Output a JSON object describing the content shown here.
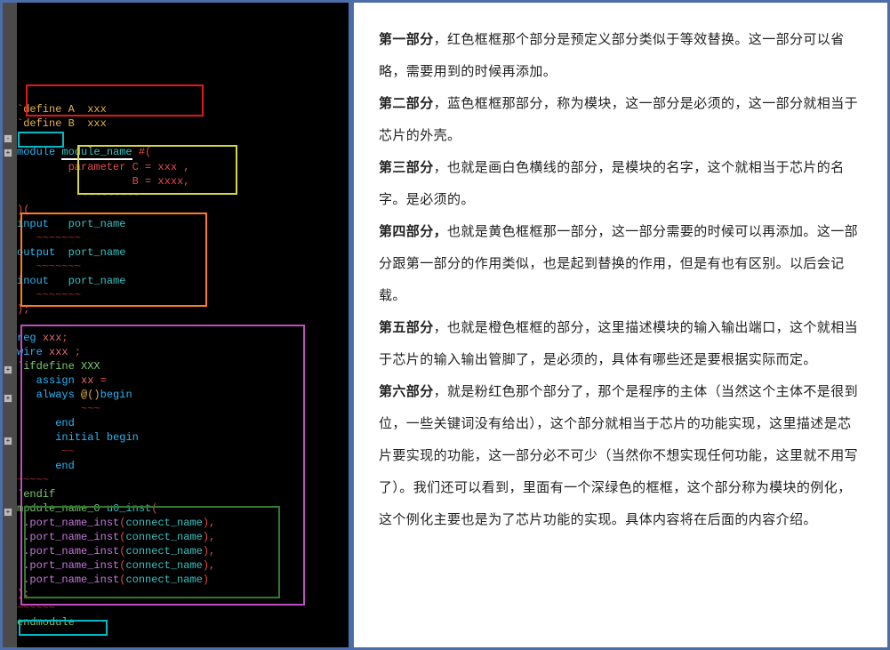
{
  "code": {
    "define_a": "`define A  xxx",
    "define_b": "`define B  xxx",
    "mod_kw": "module",
    "mod_name": "module_name",
    "hash_paren": "#(",
    "param_line1": "parameter C = xxx ,",
    "param_line2": "          B = xxxx,",
    "param_tilde": "          ~~~~~~~~~",
    "close_paren1": ")(",
    "input_l": "input   port_name",
    "output_l": "output  port_name",
    "inout_l": "inout   port_name",
    "tilde_short": "   ~~~~~~~",
    "close_paren2": ");",
    "reg_l": "reg xxx;",
    "wire_l": "wire xxx ;",
    "ifdef": "`ifdefine XXX",
    "assign_l": "   assign xx =",
    "always_l": "   always @()begin",
    "tilde_mid": "          ~~~",
    "end1": "      end",
    "initial_l": "      initial begin",
    "end2": "      end",
    "tilde_small": "~~~~~",
    "endif": "`endif",
    "inst_head": "module_name_0 u0_inst(",
    "inst_port": ".port_name_inst(connect_name),",
    "inst_close": ");",
    "endmodule": "endmodule"
  },
  "text": {
    "p1a": "第一部分",
    "p1b": "，红色框框那个部分是预定义部分类似于等效替换。这一部分可以省略，需要用到的时候再添加。",
    "p2a": "第二部分",
    "p2b": "，蓝色框框那部分，称为模块，这一部分是必须的，这一部分就相当于芯片的外壳。",
    "p3a": "第三部分",
    "p3b": "，也就是画白色横线的部分，是模块的名字，这个就相当于芯片的名字。是必须的。",
    "p4a": "第四部分，",
    "p4b": "也就是黄色框框那一部分，这一部分需要的时候可以再添加。这一部分跟第一部分的作用类似，也是起到替换的作用，但是有也有区别。以后会记载。",
    "p5a": "第五部分",
    "p5b": "，也就是橙色框框的部分，这里描述模块的输入输出端口，这个就相当于芯片的输入输出管脚了，是必须的，具体有哪些还是要根据实际而定。",
    "p6a": "第六部分",
    "p6b": "，就是粉红色那个部分了，那个是程序的主体（当然这个主体不是很到位，一些关键词没有给出），这个部分就相当于芯片的功能实现，这里描述是芯片要实现的功能，这一部分必不可少（当然你不想实现任何功能，这里就不用写了）。我们还可以看到，里面有一个深绿色的框框，这个部分称为模块的例化，这个例化主要也是为了芯片功能的实现。具体内容将在后面的内容介绍。"
  },
  "boxes": {
    "red": {
      "color": "#e01919"
    },
    "cyan": {
      "color": "#00b8c6"
    },
    "yellow": {
      "color": "#d7d73a"
    },
    "orange": {
      "color": "#ff7b24"
    },
    "pink": {
      "color": "#c24dc2"
    },
    "dgreen": {
      "color": "#2f7a2f"
    },
    "cyan2": {
      "color": "#00b8c6"
    }
  }
}
